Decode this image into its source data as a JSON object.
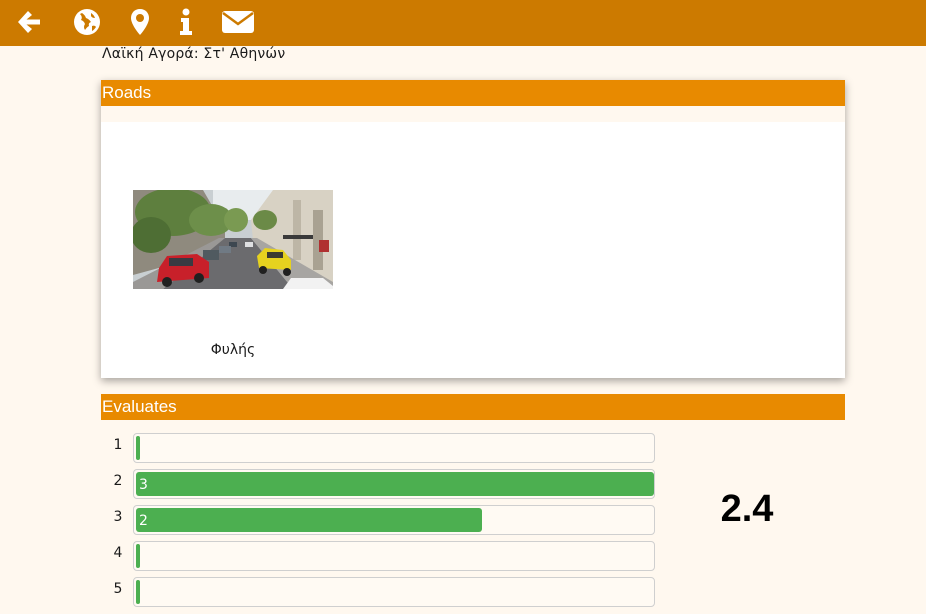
{
  "nav": {
    "icons": [
      {
        "name": "arrow-left-icon"
      },
      {
        "name": "globe-icon"
      },
      {
        "name": "map-marker-icon"
      },
      {
        "name": "info-icon"
      },
      {
        "name": "envelope-icon"
      }
    ],
    "background": "#cc7a00"
  },
  "page": {
    "title": "Λαϊκή Αγορά: Στ' Αθηνών"
  },
  "roads": {
    "header": "Roads",
    "items": [
      {
        "name": "Φυλής"
      }
    ]
  },
  "evaluates": {
    "header": "Evaluates",
    "rows": [
      {
        "label": "1",
        "count": "",
        "fraction": 0.0
      },
      {
        "label": "2",
        "count": "3",
        "fraction": 1.0
      },
      {
        "label": "3",
        "count": "2",
        "fraction": 0.667
      },
      {
        "label": "4",
        "count": "",
        "fraction": 0.0
      },
      {
        "label": "5",
        "count": "",
        "fraction": 0.0
      }
    ],
    "average": "2.4",
    "bar_color": "#4caf50"
  },
  "colors": {
    "header_bar": "#e88a00",
    "page_background": "#fff8ef"
  }
}
